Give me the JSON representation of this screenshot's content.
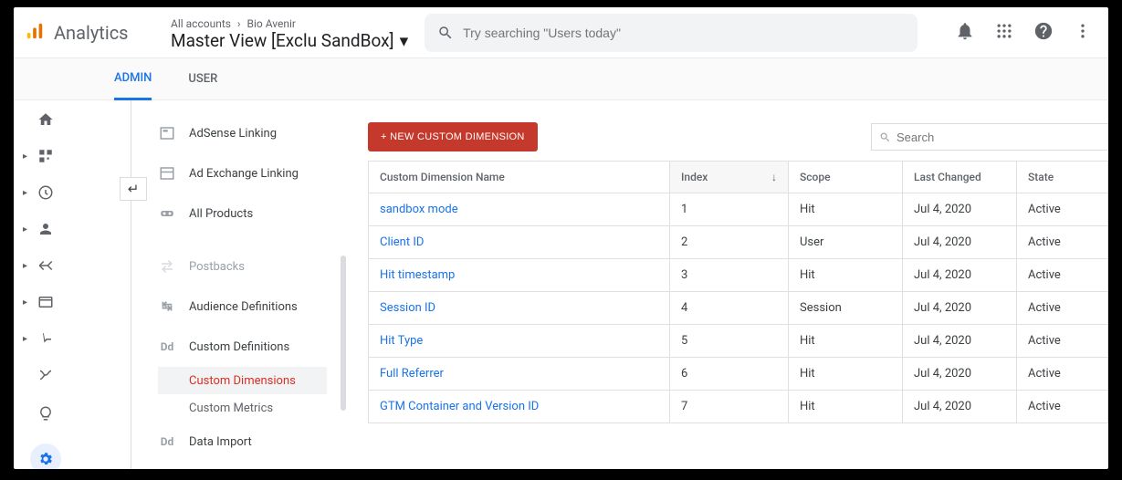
{
  "brand": "Analytics",
  "breadcrumb": {
    "level1": "All accounts",
    "level2": "Bio Avenir"
  },
  "view_name": "Master View [Exclu SandBox]",
  "search_placeholder": "Try searching \"Users today\"",
  "tabs": {
    "admin": "ADMIN",
    "user": "USER"
  },
  "sidebar": {
    "items": [
      {
        "label": "AdSense Linking"
      },
      {
        "label": "Ad Exchange Linking"
      },
      {
        "label": "All Products"
      },
      {
        "label": "Postbacks"
      },
      {
        "label": "Audience Definitions"
      },
      {
        "label": "Custom Definitions"
      },
      {
        "label": "Data Import"
      }
    ],
    "subitems": {
      "custom_dimensions": "Custom Dimensions",
      "custom_metrics": "Custom Metrics"
    }
  },
  "toolbar": {
    "new_btn": "+ NEW CUSTOM DIMENSION",
    "search_placeholder": "Search"
  },
  "table": {
    "headers": {
      "name": "Custom Dimension Name",
      "index": "Index",
      "scope": "Scope",
      "last_changed": "Last Changed",
      "state": "State"
    },
    "rows": [
      {
        "name": "sandbox mode",
        "index": "1",
        "scope": "Hit",
        "last_changed": "Jul 4, 2020",
        "state": "Active"
      },
      {
        "name": "Client ID",
        "index": "2",
        "scope": "User",
        "last_changed": "Jul 4, 2020",
        "state": "Active"
      },
      {
        "name": "Hit timestamp",
        "index": "3",
        "scope": "Hit",
        "last_changed": "Jul 4, 2020",
        "state": "Active"
      },
      {
        "name": "Session ID",
        "index": "4",
        "scope": "Session",
        "last_changed": "Jul 4, 2020",
        "state": "Active"
      },
      {
        "name": "Hit Type",
        "index": "5",
        "scope": "Hit",
        "last_changed": "Jul 4, 2020",
        "state": "Active"
      },
      {
        "name": "Full Referrer",
        "index": "6",
        "scope": "Hit",
        "last_changed": "Jul 4, 2020",
        "state": "Active"
      },
      {
        "name": "GTM Container and Version ID",
        "index": "7",
        "scope": "Hit",
        "last_changed": "Jul 4, 2020",
        "state": "Active"
      }
    ]
  }
}
